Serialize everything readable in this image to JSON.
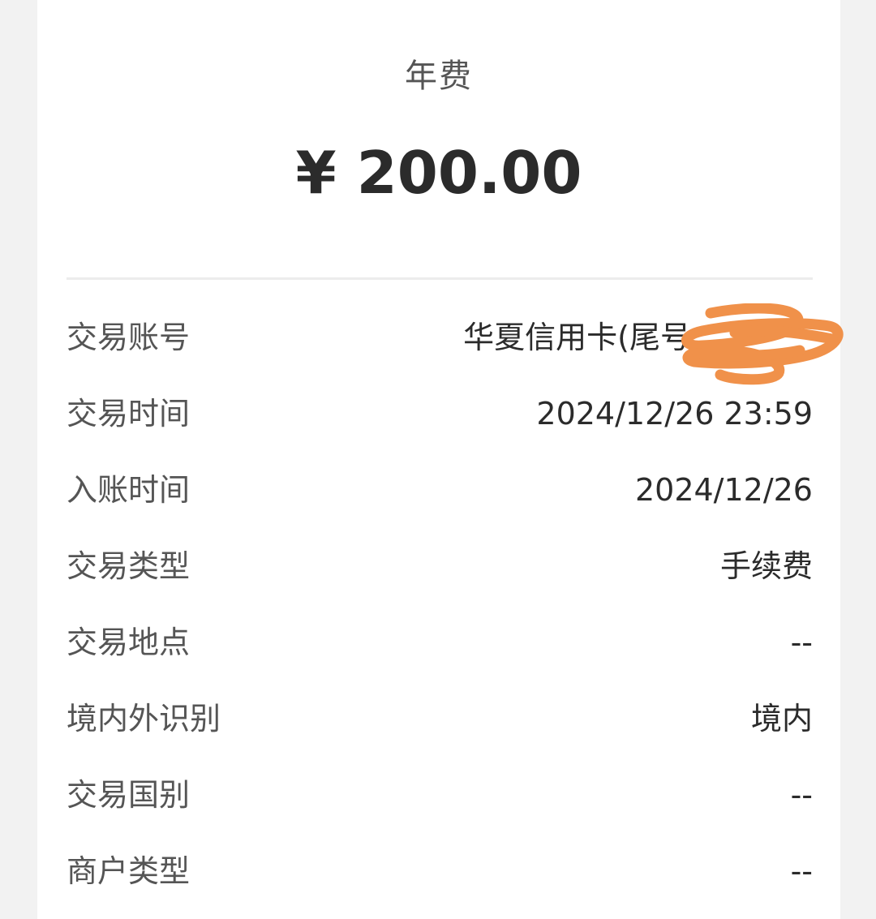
{
  "title": "年费",
  "amount": "¥ 200.00",
  "details": [
    {
      "label": "交易账号",
      "value": "华夏信用卡(尾号"
    },
    {
      "label": "交易时间",
      "value": "2024/12/26 23:59"
    },
    {
      "label": "入账时间",
      "value": "2024/12/26"
    },
    {
      "label": "交易类型",
      "value": "手续费"
    },
    {
      "label": "交易地点",
      "value": "--"
    },
    {
      "label": "境内外识别",
      "value": "境内"
    },
    {
      "label": "交易国别",
      "value": "--"
    },
    {
      "label": "商户类型",
      "value": "--"
    }
  ],
  "colors": {
    "background": "#f2f2f2",
    "card": "#ffffff",
    "label_text": "#555555",
    "value_text": "#2b2b2b",
    "redaction": "#f0914a"
  }
}
